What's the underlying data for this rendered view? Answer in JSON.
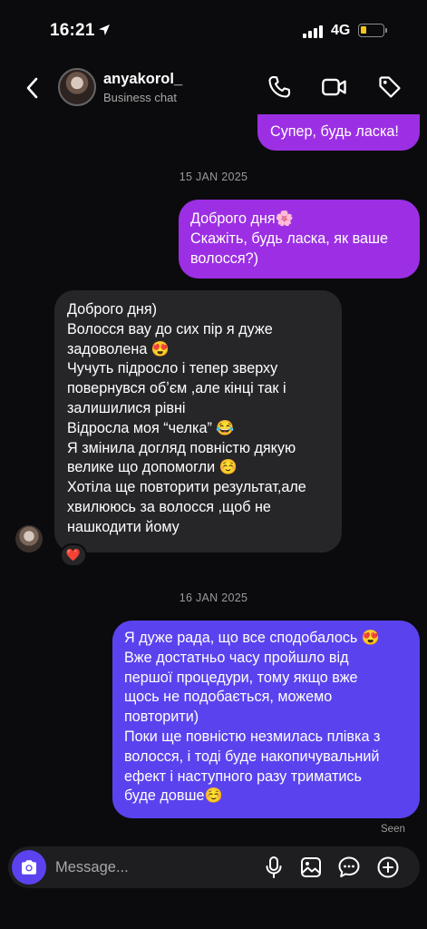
{
  "status_bar": {
    "time": "16:21",
    "network": "4G",
    "battery_level": 0.2,
    "battery_color": "#f5c518"
  },
  "header": {
    "username": "anyakorol_",
    "subtitle": "Business chat",
    "icons": [
      "back-chevron-icon",
      "phone-icon",
      "video-icon",
      "tag-icon"
    ]
  },
  "messages": {
    "m1": {
      "sender": "me",
      "lines": [
        "Супер, будь ласка!"
      ]
    },
    "date1": "15 JAN 2025",
    "m2": {
      "sender": "me",
      "lines": [
        "Доброго дня🌸",
        "Скажіть, будь ласка, як ваше",
        "волосся?)"
      ]
    },
    "m3": {
      "sender": "anyakorol_",
      "lines": [
        "Доброго дня)",
        "Волосся вау до сих пір я дуже",
        "задоволена 😍",
        "Чучуть підросло і тепер зверху",
        "повернувся обʼєм ,але кінці так і",
        "залишилися рівні",
        "Відросла моя “челка” 😂",
        "Я змінила догляд повністю дякую",
        "велике що допомогли ☺️",
        "Хотіла ще повторити результат,але",
        "хвилююсь за волосся ,щоб не",
        "нашкодити йому"
      ],
      "reaction": "❤️"
    },
    "date2": "16 JAN 2025",
    "m4": {
      "sender": "me",
      "lines": [
        "Я дуже рада, що все сподобалось 😍",
        "Вже достатньо часу пройшло від",
        "першої процедури, тому якщо вже",
        "щось не подобається, можемо",
        "повторити)",
        "Поки ще повністю незмилась плівка з",
        "волосся, і тоді буде накопичувальний",
        "ефект і наступного разу триматись",
        "буде довше☺️"
      ]
    },
    "seen": "Seen"
  },
  "composer": {
    "placeholder": "Message...",
    "value": "",
    "icons": [
      "camera-icon",
      "microphone-icon",
      "gallery-icon",
      "sticker-icon",
      "add-icon"
    ]
  },
  "colors": {
    "background": "#0b0b0d",
    "outgoing_purple": "#9c2fe3",
    "outgoing_blue": "#5a43ee",
    "incoming": "#262629"
  }
}
